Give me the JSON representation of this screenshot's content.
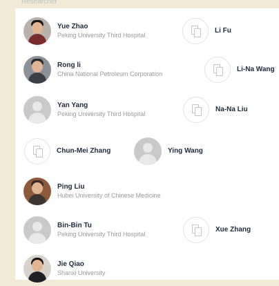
{
  "top_clip": "Researcher",
  "rows": [
    {
      "left": {
        "name": "Yue Zhao",
        "affiliation": "Peking University Third Hospital",
        "avatar": "photo-female-icon"
      },
      "right": {
        "name": "Li Fu",
        "avatar": "organization-icon"
      }
    },
    {
      "left": {
        "name": "Rong li",
        "affiliation": "China National Petroleum Corporation",
        "avatar": "photo-male-icon"
      },
      "right": {
        "name": "Li-Na Wang",
        "avatar": "organization-icon"
      }
    },
    {
      "left": {
        "name": "Yan Yang",
        "affiliation": "Peking University Third Hospital",
        "avatar": "default-avatar-icon"
      },
      "right": {
        "name": "Na-Na Liu",
        "avatar": "organization-icon"
      }
    },
    {
      "left": {
        "name": "Chun-Mei Zhang",
        "avatar": "organization-icon"
      },
      "right": {
        "name": "Ying Wang",
        "avatar": "default-avatar-icon"
      }
    },
    {
      "left": {
        "name": "Ping Liu",
        "affiliation": "Hubei University of Chinese Medicine",
        "avatar": "photo-male-icon"
      }
    },
    {
      "left": {
        "name": "Bin-Bin Tu",
        "affiliation": "Peking University Third Hospital",
        "avatar": "default-avatar-icon"
      },
      "right": {
        "name": "Xue Zhang",
        "avatar": "organization-icon"
      }
    },
    {
      "left": {
        "name": "Jie Qiao",
        "affiliation": "Shanxi University",
        "avatar": "photo-female-icon"
      }
    }
  ]
}
